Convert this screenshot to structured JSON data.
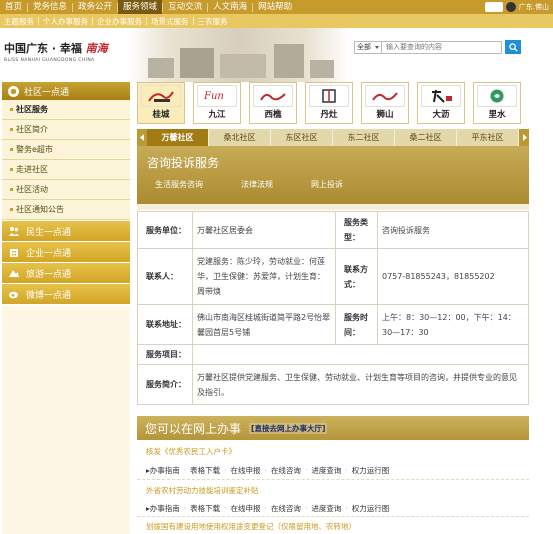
{
  "topnav": {
    "items": [
      "首页",
      "党务信息",
      "政务公开",
      "服务领域",
      "互动交流",
      "人文南海",
      "网站帮助"
    ],
    "active_index": 3,
    "location": "广东.佛山"
  },
  "subnav": {
    "items": [
      "主题服务",
      "个人办事服务",
      "企业办事服务",
      "场景式服务",
      "三农服务"
    ]
  },
  "header": {
    "logo_main": "中国广东 · 幸福 ",
    "logo_mark": "南海",
    "logo_sub": "BLISS NANHAI GUANGDONG CHINA",
    "search_scope": "全部",
    "search_placeholder": "输入要查询的内容"
  },
  "sidebar": {
    "head": "社区一点通",
    "items": [
      "社区服务",
      "社区简介",
      "警务e超市",
      "走进社区",
      "社区活动",
      "社区通知公告"
    ],
    "active_index": 0,
    "categories": [
      "民生一点通",
      "企业一点通",
      "旅游一点通",
      "微博一点通"
    ]
  },
  "communities": {
    "items": [
      "桂城",
      "九江",
      "西樵",
      "丹灶",
      "狮山",
      "大沥",
      "里水"
    ],
    "active_index": 0
  },
  "tabs": {
    "items": [
      "万馨社区",
      "桑北社区",
      "东区社区",
      "东二社区",
      "桑二社区",
      "平东社区"
    ],
    "active_index": 0
  },
  "service": {
    "title": "咨询投诉服务",
    "links": [
      "生活服务咨询",
      "法律法规",
      "网上投诉"
    ]
  },
  "info": {
    "unit_label": "服务单位：",
    "unit_value": "万馨社区居委会",
    "type_label": "服务类型：",
    "type_value": "咨询投诉服务",
    "contact_label": "联系人：",
    "contact_value": "党建服务：陈少玲，劳动就业：何莲华，卫生保健：苏爱萍，计划生育：周带焕",
    "phone_label": "联系方式：",
    "phone_value": "0757-81855243，81855202",
    "address_label": "联系地址：",
    "address_value": "佛山市南海区桂城街道简平路2号怡翠馨园首层5号铺",
    "time_label": "服务时间：",
    "time_value": "上午：8：30—12：00，下午：14：30—17：30",
    "item_label": "服务项目：",
    "item_value": "",
    "desc_label": "服务简介：",
    "desc_value": "万馨社区提供党建服务、卫生保健、劳动就业、计划生育等项目的咨询，并提供专业的意见及指引。"
  },
  "online": {
    "title": "您可以在网上办事",
    "link": "[直接去网上办事大厅]",
    "groups": [
      {
        "name": "核发《优秀农民工入户卡》",
        "links": [
          "办事指南",
          "表格下载",
          "在线申报",
          "在线咨询",
          "进度查询",
          "权力运行图"
        ]
      },
      {
        "name": "外省农村劳动力技能培训鉴定补贴",
        "links": [
          "办事指南",
          "表格下载",
          "在线申报",
          "在线咨询",
          "进度查询",
          "权力运行图"
        ]
      },
      {
        "name": "划拨国有建设用地使用权用途变更登记（仅限留用地、农转地）",
        "links": []
      }
    ]
  },
  "colors": {
    "gold": "#c79a2c",
    "gold_dark": "#a27b13",
    "link_blue": "#1f8fd6"
  }
}
